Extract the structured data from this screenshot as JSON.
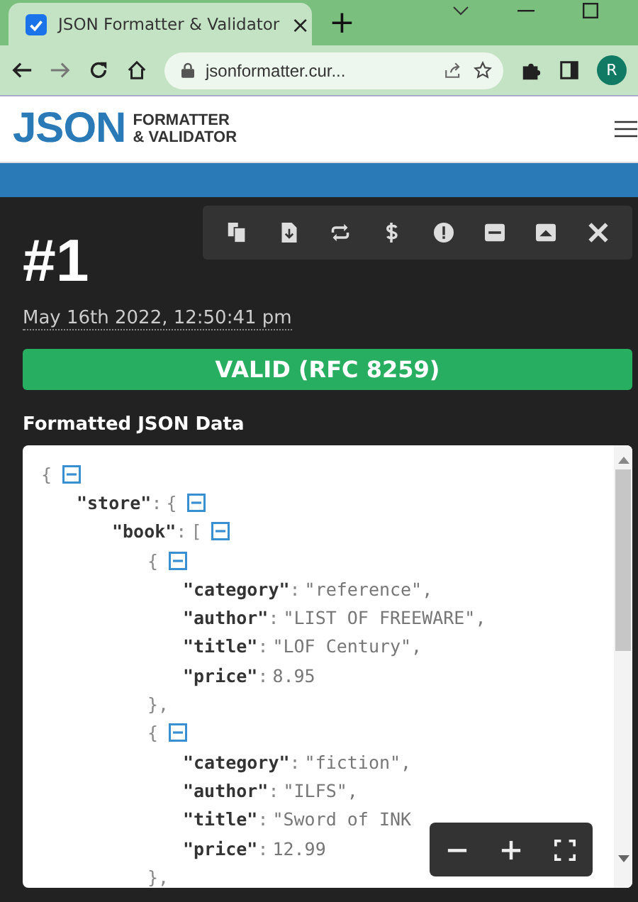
{
  "browser": {
    "tab": {
      "title": "JSON Formatter & Validator",
      "close": "×",
      "selected": true
    },
    "new_tab": "+",
    "url": "jsonformatter.cur...",
    "avatar": "R"
  },
  "site": {
    "logo_main": "JSON",
    "logo_line1": "FORMATTER",
    "logo_line2": "& VALIDATOR"
  },
  "result": {
    "number": "#1",
    "timestamp": "May 16th 2022, 12:50:41 pm",
    "status": "VALID (RFC 8259)",
    "valid": true,
    "heading": "Formatted JSON Data"
  },
  "tree": {
    "open": "{",
    "children": [
      {
        "key": "\"store\"",
        "sep": ":",
        "open": "{",
        "children": [
          {
            "key": "\"book\"",
            "sep": ":",
            "open": "[",
            "children": [
              {
                "open": "{",
                "close": "},",
                "children": [
                  {
                    "key": "\"category\"",
                    "sep": ":",
                    "value": "\"reference\","
                  },
                  {
                    "key": "\"author\"",
                    "sep": ":",
                    "value": "\"LIST OF FREEWARE\","
                  },
                  {
                    "key": "\"title\"",
                    "sep": ":",
                    "value": "\"LOF Century\","
                  },
                  {
                    "key": "\"price\"",
                    "sep": ":",
                    "value": "8.95"
                  }
                ]
              },
              {
                "open": "{",
                "close": "},",
                "children": [
                  {
                    "key": "\"category\"",
                    "sep": ":",
                    "value": "\"fiction\","
                  },
                  {
                    "key": "\"author\"",
                    "sep": ":",
                    "value": "\"ILFS\","
                  },
                  {
                    "key": "\"title\"",
                    "sep": ":",
                    "value": "\"Sword of INK"
                  },
                  {
                    "key": "\"price\"",
                    "sep": ":",
                    "value": "12.99"
                  }
                ]
              }
            ]
          }
        ]
      }
    ]
  }
}
